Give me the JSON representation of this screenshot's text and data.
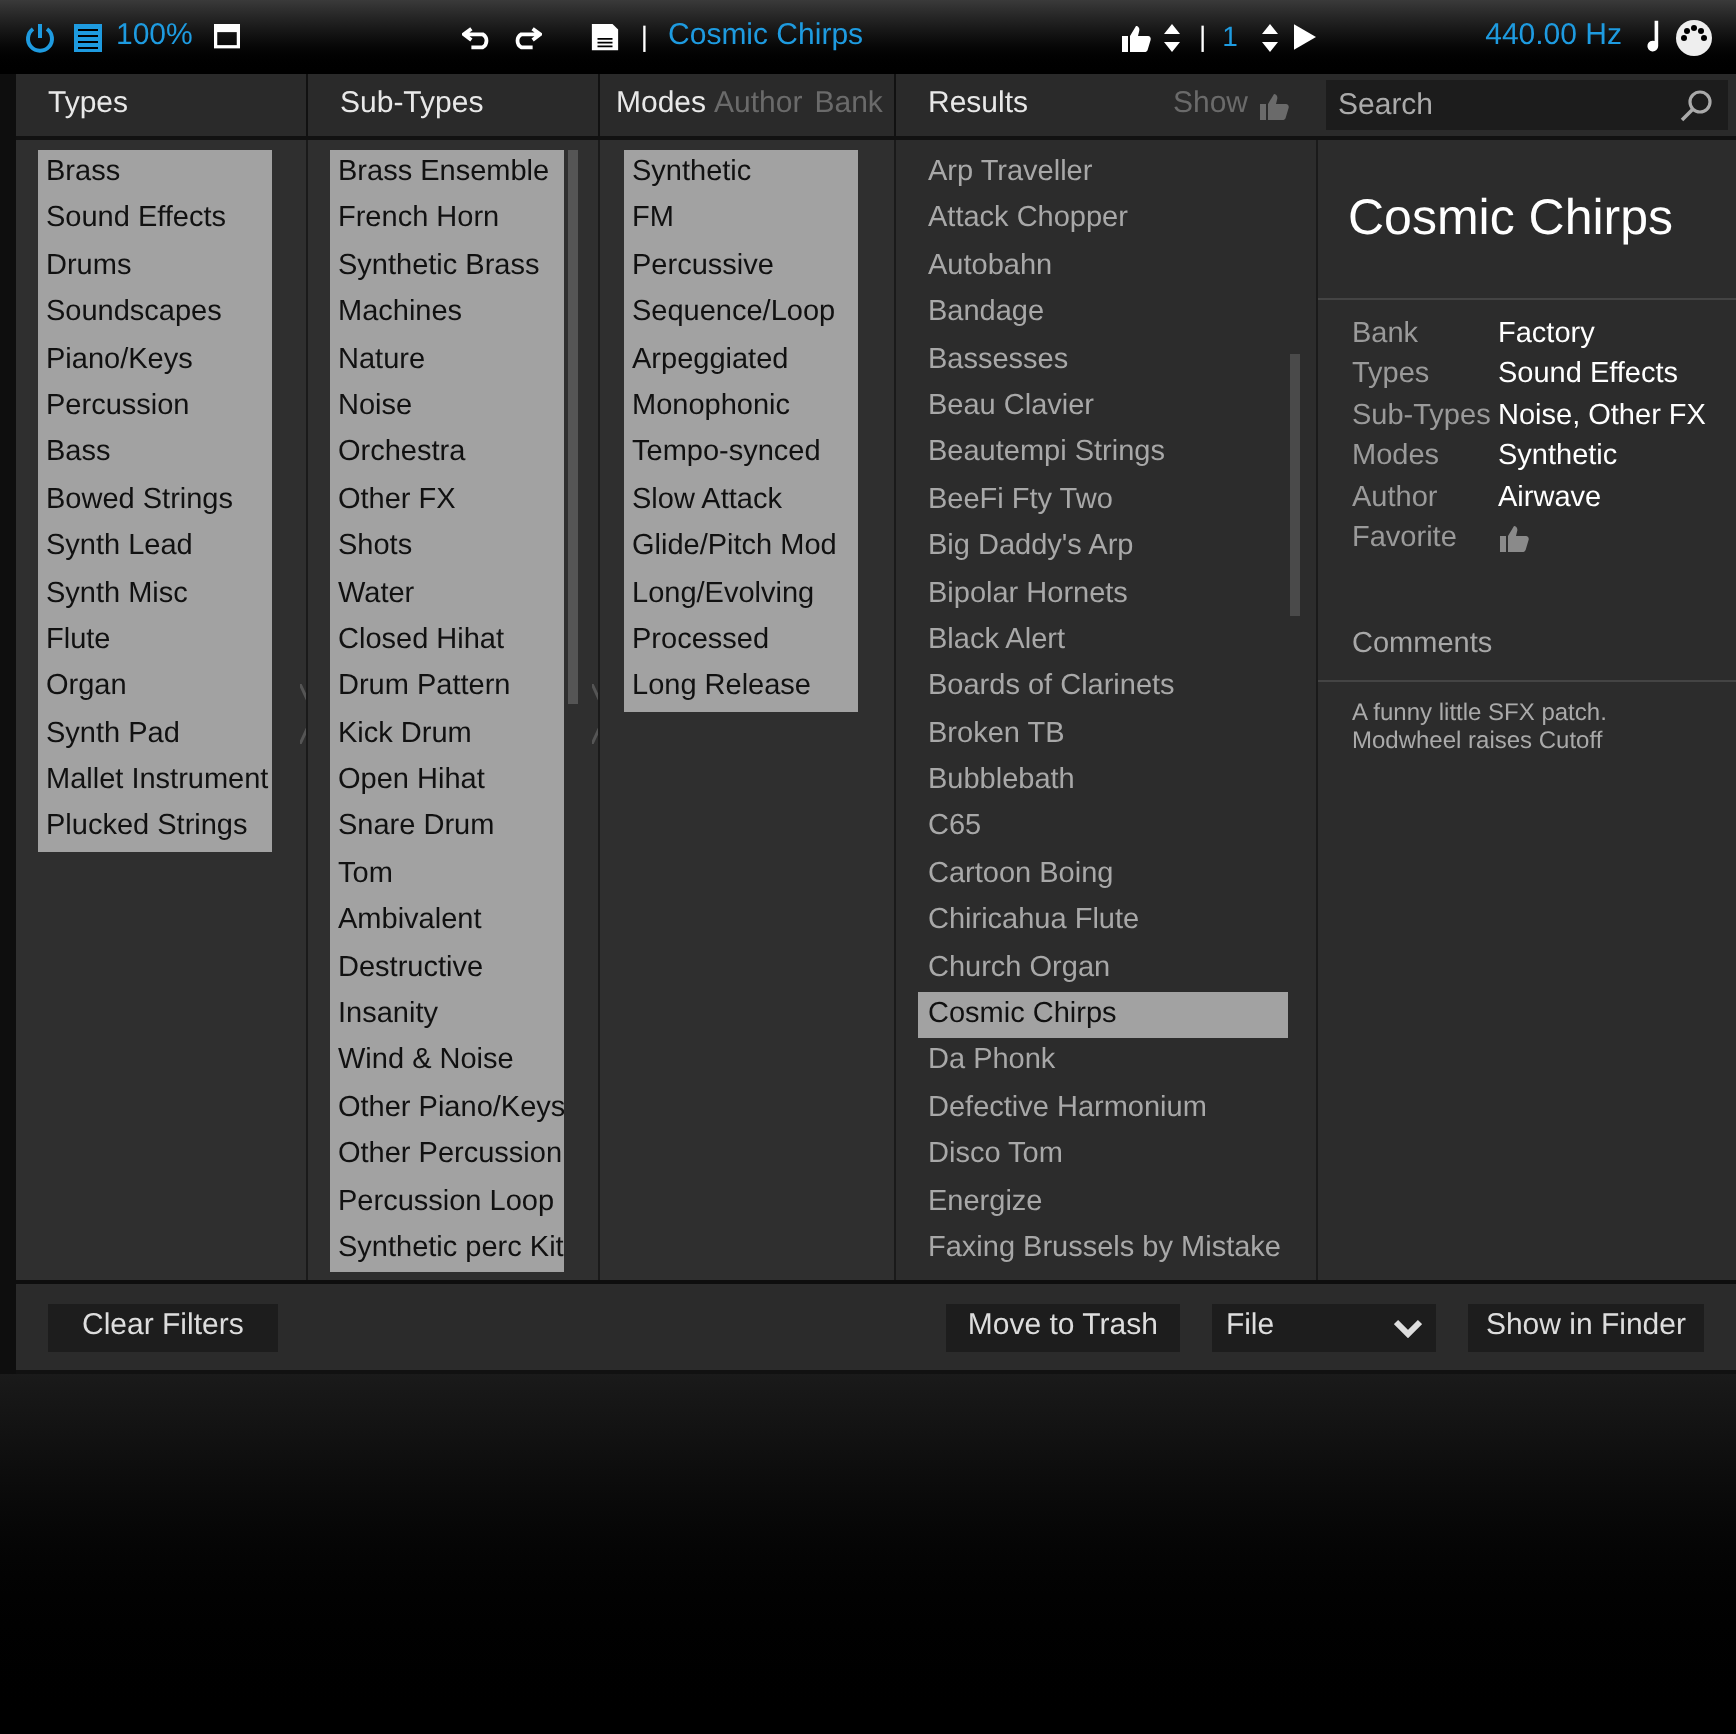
{
  "toolbar": {
    "zoom": "100%",
    "patch_name": "Cosmic Chirps",
    "separator": "|",
    "program": "1",
    "frequency": "440.00 Hz"
  },
  "headers": {
    "types": "Types",
    "sub_types": "Sub-Types",
    "modes": "Modes",
    "author": "Author",
    "bank": "Bank",
    "results": "Results",
    "show": "Show",
    "search_placeholder": "Search"
  },
  "types": [
    {
      "label": "Brass",
      "selected": true
    },
    {
      "label": "Sound Effects",
      "selected": true
    },
    {
      "label": "Drums",
      "selected": true
    },
    {
      "label": "Soundscapes",
      "selected": true
    },
    {
      "label": "Piano/Keys",
      "selected": true
    },
    {
      "label": "Percussion",
      "selected": true
    },
    {
      "label": "Bass",
      "selected": true
    },
    {
      "label": "Bowed Strings",
      "selected": true
    },
    {
      "label": "Synth Lead",
      "selected": true
    },
    {
      "label": "Synth Misc",
      "selected": true
    },
    {
      "label": "Flute",
      "selected": true
    },
    {
      "label": "Organ",
      "selected": true
    },
    {
      "label": "Synth Pad",
      "selected": true
    },
    {
      "label": "Mallet Instrument",
      "selected": true
    },
    {
      "label": "Plucked Strings",
      "selected": true
    }
  ],
  "sub_types": [
    {
      "label": "Brass Ensemble",
      "selected": true
    },
    {
      "label": "French Horn",
      "selected": true
    },
    {
      "label": "Synthetic Brass",
      "selected": true
    },
    {
      "label": "Machines",
      "selected": true
    },
    {
      "label": "Nature",
      "selected": true
    },
    {
      "label": "Noise",
      "selected": true
    },
    {
      "label": "Orchestra",
      "selected": true
    },
    {
      "label": "Other FX",
      "selected": true
    },
    {
      "label": "Shots",
      "selected": true
    },
    {
      "label": "Water",
      "selected": true
    },
    {
      "label": "Closed Hihat",
      "selected": true
    },
    {
      "label": "Drum Pattern",
      "selected": true
    },
    {
      "label": "Kick Drum",
      "selected": true
    },
    {
      "label": "Open Hihat",
      "selected": true
    },
    {
      "label": "Snare Drum",
      "selected": true
    },
    {
      "label": "Tom",
      "selected": true
    },
    {
      "label": "Ambivalent",
      "selected": true
    },
    {
      "label": "Destructive",
      "selected": true
    },
    {
      "label": "Insanity",
      "selected": true
    },
    {
      "label": "Wind & Noise",
      "selected": true
    },
    {
      "label": "Other Piano/Keys",
      "selected": true
    },
    {
      "label": "Other Percussion",
      "selected": true
    },
    {
      "label": "Percussion Loop",
      "selected": true
    },
    {
      "label": "Synthetic perc Kit",
      "selected": true
    }
  ],
  "modes": [
    {
      "label": "Synthetic",
      "selected": true
    },
    {
      "label": "FM",
      "selected": true
    },
    {
      "label": "Percussive",
      "selected": true
    },
    {
      "label": "Sequence/Loop",
      "selected": true
    },
    {
      "label": "Arpeggiated",
      "selected": true
    },
    {
      "label": "Monophonic",
      "selected": true
    },
    {
      "label": "Tempo-synced",
      "selected": true
    },
    {
      "label": "Slow Attack",
      "selected": true
    },
    {
      "label": "Glide/Pitch Mod",
      "selected": true
    },
    {
      "label": "Long/Evolving",
      "selected": true
    },
    {
      "label": "Processed",
      "selected": true
    },
    {
      "label": "Long Release",
      "selected": true
    }
  ],
  "results": [
    {
      "label": "Arp Traveller",
      "selected": false
    },
    {
      "label": "Attack Chopper",
      "selected": false
    },
    {
      "label": "Autobahn",
      "selected": false
    },
    {
      "label": "Bandage",
      "selected": false
    },
    {
      "label": "Bassesses",
      "selected": false
    },
    {
      "label": "Beau Clavier",
      "selected": false
    },
    {
      "label": "Beautempi Strings",
      "selected": false
    },
    {
      "label": "BeeFi Fty Two",
      "selected": false
    },
    {
      "label": "Big Daddy's Arp",
      "selected": false
    },
    {
      "label": "Bipolar Hornets",
      "selected": false
    },
    {
      "label": "Black Alert",
      "selected": false
    },
    {
      "label": "Boards of Clarinets",
      "selected": false
    },
    {
      "label": "Broken TB",
      "selected": false
    },
    {
      "label": "Bubblebath",
      "selected": false
    },
    {
      "label": "C65",
      "selected": false
    },
    {
      "label": "Cartoon Boing",
      "selected": false
    },
    {
      "label": "Chiricahua Flute",
      "selected": false
    },
    {
      "label": "Church Organ",
      "selected": false
    },
    {
      "label": "Cosmic Chirps",
      "selected": true
    },
    {
      "label": "Da Phonk",
      "selected": false
    },
    {
      "label": "Defective Harmonium",
      "selected": false
    },
    {
      "label": "Disco Tom",
      "selected": false
    },
    {
      "label": "Energize",
      "selected": false
    },
    {
      "label": "Faxing Brussels by Mistake",
      "selected": false
    }
  ],
  "info": {
    "title": "Cosmic Chirps",
    "fields": [
      {
        "label": "Bank",
        "value": "Factory"
      },
      {
        "label": "Types",
        "value": "Sound Effects"
      },
      {
        "label": "Sub-Types",
        "value": "Noise, Other FX"
      },
      {
        "label": "Modes",
        "value": "Synthetic"
      },
      {
        "label": "Author",
        "value": "Airwave"
      },
      {
        "label": "Favorite",
        "kind": "thumb"
      }
    ],
    "comments_heading": "Comments",
    "comments": "A funny little SFX patch.\nModwheel raises Cutoff"
  },
  "footer": {
    "clear": "Clear Filters",
    "trash": "Move to Trash",
    "file": "File",
    "finder": "Show in Finder"
  }
}
